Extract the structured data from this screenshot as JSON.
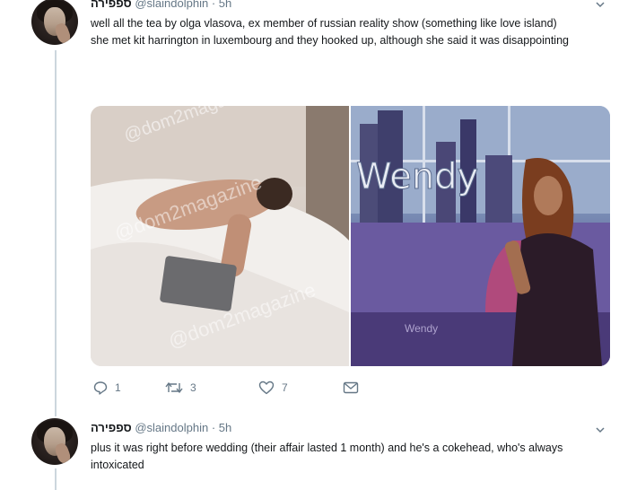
{
  "tweets": [
    {
      "display_name": "ספפירה",
      "handle": "@slaindolphin",
      "time": "5h",
      "lines": [
        "well all the tea by olga vlasova, ex member of russian reality show (something like love island)",
        "she met kit harrington in luxembourg and they hooked up, although she said it was disappointing"
      ],
      "media": {
        "left_watermark": "@dom2magazine",
        "right_logo": "Wendy",
        "right_floor_text": "Wendy"
      },
      "actions": {
        "replies": "1",
        "retweets": "3",
        "likes": "7"
      }
    },
    {
      "display_name": "ספפירה",
      "handle": "@slaindolphin",
      "time": "5h",
      "lines": [
        "plus it was right before wedding (their affair lasted 1 month) and he's a cokehead, who's always intoxicated"
      ]
    }
  ],
  "icons": {
    "reply": "reply-icon",
    "retweet": "retweet-icon",
    "like": "heart-icon",
    "dm": "envelope-icon",
    "more": "chevron-down-icon"
  },
  "colors": {
    "meta": "#657786",
    "text": "#14171a",
    "thread": "#ccd6dd"
  }
}
